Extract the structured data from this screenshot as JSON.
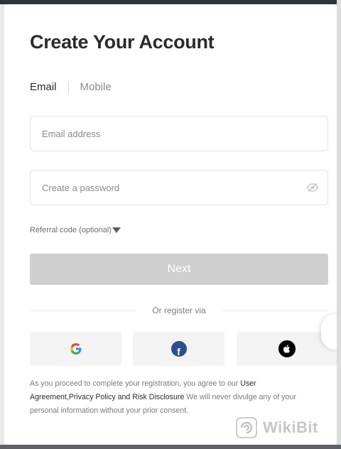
{
  "form": {
    "title": "Create Your Account",
    "tabs": {
      "email": "Email",
      "mobile": "Mobile"
    },
    "email_placeholder": "Email address",
    "password_placeholder": "Create a password",
    "referral_label": "Referral code (optional)",
    "next_label": "Next",
    "or_register": "Or register via"
  },
  "social": {
    "google_letter": "G",
    "facebook_letter": "f",
    "icons": [
      "google-icon",
      "facebook-icon",
      "apple-icon"
    ]
  },
  "legal": {
    "prefix": "As you proceed to complete your registration, you agree to our ",
    "link_text": "User Agreement,Privacy Policy and Risk Disclosure",
    "suffix": " We will never divulge any of your personal information without your prior consent."
  },
  "watermark": {
    "text": "WikiBit"
  },
  "colors": {
    "button_disabled": "#cfcfcf",
    "facebook": "#2c4d8f",
    "title": "#2b2b2b"
  }
}
